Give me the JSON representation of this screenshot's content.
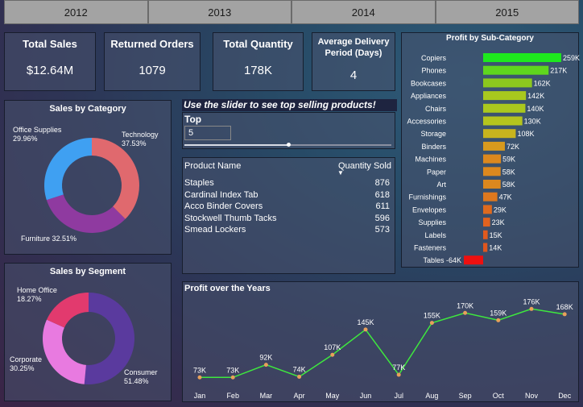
{
  "years": [
    "2012",
    "2013",
    "2014",
    "2015"
  ],
  "kpis": {
    "total_sales": {
      "label": "Total Sales",
      "value": "$12.64M"
    },
    "returned_orders": {
      "label": "Returned Orders",
      "value": "1079"
    },
    "total_quantity": {
      "label": "Total Quantity",
      "value": "178K"
    },
    "avg_delivery": {
      "label": "Average Delivery Period (Days)",
      "value": "4"
    }
  },
  "slider": {
    "instruction": "Use the slider to see top selling products!",
    "title": "Top",
    "value": "5",
    "fraction": 0.5
  },
  "product_table": {
    "col_product": "Product Name",
    "col_qty": "Quantity Sold",
    "rows": [
      {
        "name": "Staples",
        "qty": "876"
      },
      {
        "name": "Cardinal Index Tab",
        "qty": "618"
      },
      {
        "name": "Acco Binder Covers",
        "qty": "611"
      },
      {
        "name": "Stockwell Thumb Tacks",
        "qty": "596"
      },
      {
        "name": "Smead Lockers",
        "qty": "573"
      }
    ]
  },
  "chart_data": [
    {
      "type": "pie",
      "title": "Sales by Category",
      "categories": [
        "Technology",
        "Furniture",
        "Office Supplies"
      ],
      "values": [
        37.53,
        32.51,
        29.96
      ],
      "labels": [
        "Technology\n37.53%",
        "Furniture 32.51%",
        "Office Supplies\n29.96%"
      ],
      "colors": [
        "#e0696e",
        "#8f3aa0",
        "#3fa0f2"
      ]
    },
    {
      "type": "pie",
      "title": "Sales by Segment",
      "categories": [
        "Consumer",
        "Corporate",
        "Home Office"
      ],
      "values": [
        51.48,
        30.25,
        18.27
      ],
      "labels": [
        "Consumer\n51.48%",
        "Corporate\n30.25%",
        "Home Office\n18.27%"
      ],
      "colors": [
        "#5a3a9e",
        "#e87ae0",
        "#e23a6e"
      ]
    },
    {
      "type": "bar",
      "orientation": "horizontal",
      "title": "Profit by Sub-Category",
      "categories": [
        "Copiers",
        "Phones",
        "Bookcases",
        "Appliances",
        "Chairs",
        "Accessories",
        "Storage",
        "Binders",
        "Machines",
        "Paper",
        "Art",
        "Furnishings",
        "Envelopes",
        "Supplies",
        "Labels",
        "Fasteners",
        "Tables"
      ],
      "values": [
        259000,
        217000,
        162000,
        142000,
        140000,
        130000,
        108000,
        72000,
        59000,
        58000,
        58000,
        47000,
        29000,
        23000,
        15000,
        14000,
        -64000
      ],
      "data_labels": [
        "259K",
        "217K",
        "162K",
        "142K",
        "140K",
        "130K",
        "108K",
        "72K",
        "59K",
        "58K",
        "58K",
        "47K",
        "29K",
        "23K",
        "15K",
        "14K",
        "-64K"
      ],
      "colors": [
        "#1ee81e",
        "#5fd61e",
        "#8cc81e",
        "#a8c81e",
        "#aac81e",
        "#b4c41e",
        "#c8b41e",
        "#d89a1e",
        "#dc881e",
        "#dc881e",
        "#dc881e",
        "#de781e",
        "#de6a1e",
        "#e0621e",
        "#e05a1e",
        "#e0561e",
        "#ee1010"
      ]
    },
    {
      "type": "line",
      "title": "Profit over the Years",
      "categories": [
        "Jan",
        "Feb",
        "Mar",
        "Apr",
        "May",
        "Jun",
        "Jul",
        "Aug",
        "Sep",
        "Oct",
        "Nov",
        "Dec"
      ],
      "values": [
        73000,
        73000,
        92000,
        74000,
        107000,
        145000,
        77000,
        155000,
        170000,
        159000,
        176000,
        168000
      ],
      "data_labels": [
        "73K",
        "73K",
        "92K",
        "74K",
        "107K",
        "145K",
        "77K",
        "155K",
        "170K",
        "159K",
        "176K",
        "168K"
      ],
      "line_color": "#3ee83e",
      "marker_color": "#e8a05a"
    }
  ]
}
